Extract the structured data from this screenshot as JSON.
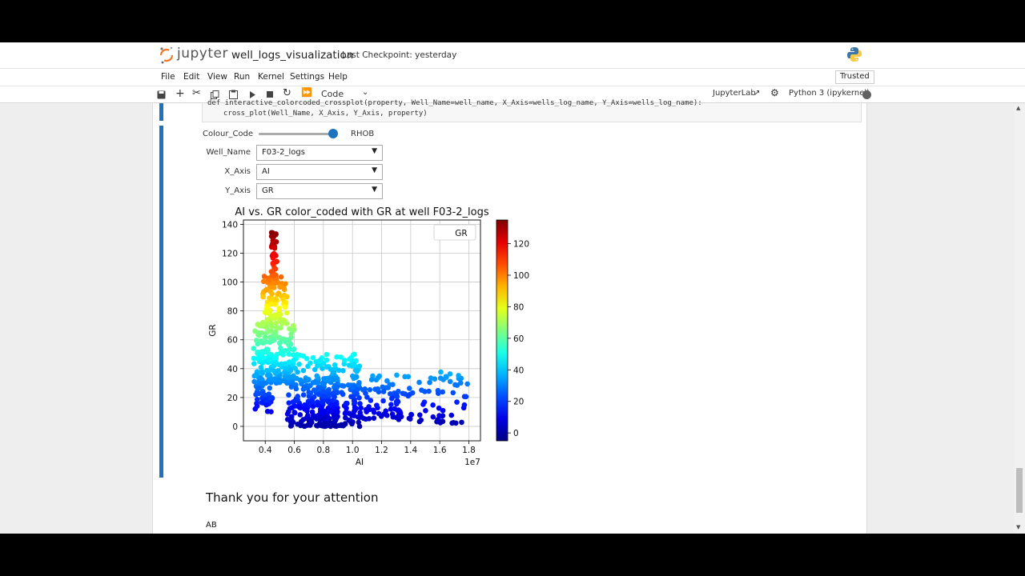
{
  "header": {
    "logo_text": "jupyter",
    "notebook_title": "well_logs_visualization",
    "checkpoint": "Last Checkpoint: yesterday"
  },
  "menu": {
    "items": [
      "File",
      "Edit",
      "View",
      "Run",
      "Kernel",
      "Settings",
      "Help"
    ],
    "trusted": "Trusted"
  },
  "toolbar": {
    "cell_type": "Code",
    "jupyterlab": "JupyterLab",
    "kernel": "Python 3 (ipykernel)"
  },
  "code": {
    "line1": "def interactive_colorcoded_crossplot(property, Well_Name=well_name, X_Axis=wells_log_name, Y_Axis=wells_log_name):",
    "line2": "cross_plot(Well_Name, X_Axis, Y_Axis, property)"
  },
  "widgets": {
    "colour_code_label": "Colour_Code",
    "colour_code_value": "RHOB",
    "colour_code_level": 0.95,
    "well_name_label": "Well_Name",
    "well_name_value": "F03-2_logs",
    "x_axis_label": "X_Axis",
    "x_axis_value": "AI",
    "y_axis_label": "Y_Axis",
    "y_axis_value": "GR"
  },
  "chart_data": {
    "type": "scatter",
    "title": "AI vs. GR color_coded with GR at well F03-2_logs",
    "xlabel": "AI",
    "ylabel": "GR",
    "x_offset_label": "1e7",
    "xlim": [
      0.25,
      1.88
    ],
    "ylim": [
      -10,
      143
    ],
    "xticks": [
      "0.4",
      "0.6",
      "0.8",
      "1.0",
      "1.2",
      "1.4",
      "1.6",
      "1.8"
    ],
    "yticks": [
      "0",
      "20",
      "40",
      "60",
      "80",
      "100",
      "120",
      "140"
    ],
    "grid": true,
    "legend": {
      "label": "GR",
      "position": "top-right"
    },
    "colorbar": {
      "range": [
        -5,
        135
      ],
      "ticks": [
        "0",
        "20",
        "40",
        "60",
        "80",
        "100",
        "120"
      ],
      "colormap": "jet"
    },
    "clusters": [
      {
        "x_range": [
          0.44,
          0.48
        ],
        "y_range": [
          100,
          135
        ],
        "count": 45
      },
      {
        "x_range": [
          0.38,
          0.55
        ],
        "y_range": [
          70,
          105
        ],
        "count": 90
      },
      {
        "x_range": [
          0.32,
          0.6
        ],
        "y_range": [
          30,
          72
        ],
        "count": 180
      },
      {
        "x_range": [
          0.33,
          0.45
        ],
        "y_range": [
          10,
          30
        ],
        "count": 40
      },
      {
        "x_range": [
          0.55,
          1.05
        ],
        "y_range": [
          0,
          50
        ],
        "count": 260
      },
      {
        "x_range": [
          0.75,
          0.9
        ],
        "y_range": [
          0,
          35
        ],
        "count": 120
      },
      {
        "x_range": [
          1.0,
          1.35
        ],
        "y_range": [
          5,
          35
        ],
        "count": 80
      },
      {
        "x_range": [
          1.3,
          1.8
        ],
        "y_range": [
          2,
          38
        ],
        "count": 70
      }
    ]
  },
  "footer": {
    "thanks": "Thank you for your attention",
    "ab": "AB"
  }
}
